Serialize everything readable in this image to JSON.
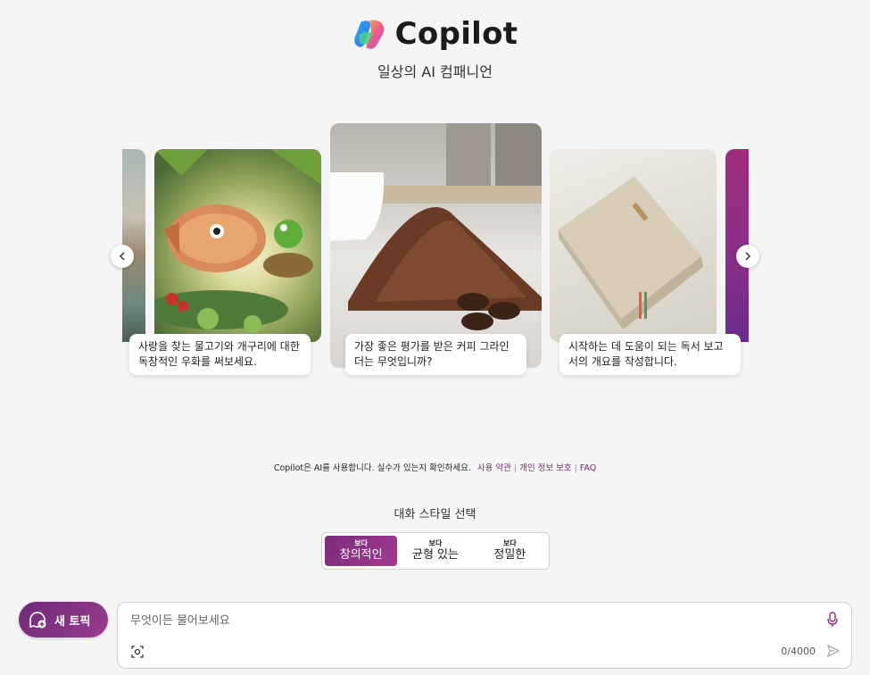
{
  "header": {
    "brand_name": "Copilot",
    "subtitle": "일상의 AI 컴패니언"
  },
  "carousel": {
    "cards": [
      {
        "caption": "사랑을 찾는 물고기와 개구리에 대한 독창적인 우화를 써보세요."
      },
      {
        "caption": "가장 좋은 평가를 받은 커피 그라인더는 무엇입니까?"
      },
      {
        "caption": "시작하는 데 도움이 되는 독서 보고서의 개요를 작성합니다."
      }
    ]
  },
  "disclaimer": {
    "text": "Copilot은 AI를 사용합니다. 실수가 있는지 확인하세요.",
    "terms": "사용 약관",
    "privacy": "개인 정보 보호",
    "faq": "FAQ"
  },
  "conversation_style": {
    "title": "대화 스타일 선택",
    "options": [
      {
        "small": "보다",
        "label": "창의적인",
        "active": true
      },
      {
        "small": "보다",
        "label": "균형 있는",
        "active": false
      },
      {
        "small": "보다",
        "label": "정밀한",
        "active": false
      }
    ]
  },
  "composer": {
    "new_topic": "새 토픽",
    "placeholder": "무엇이든 물어보세요",
    "counter": "0/4000"
  },
  "colors": {
    "accent": "#8a2e82",
    "background": "#f5f5f5"
  },
  "icons": [
    "copilot-logo",
    "chevron-left-icon",
    "chevron-right-icon",
    "new-topic-icon",
    "mic-icon",
    "camera-icon",
    "send-icon"
  ]
}
